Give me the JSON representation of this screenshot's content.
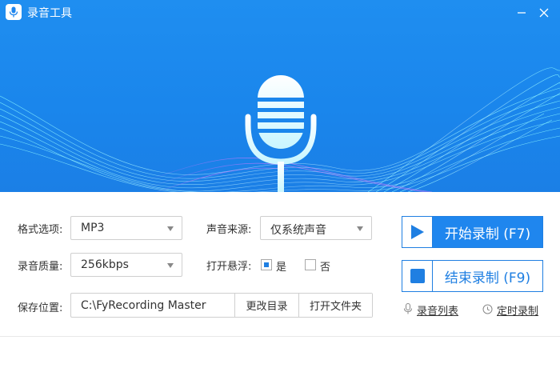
{
  "window": {
    "title": "录音工具"
  },
  "settings": {
    "format_label": "格式选项:",
    "format_value": "MP3",
    "quality_label": "录音质量:",
    "quality_value": "256kbps",
    "save_label": "保存位置:",
    "save_path": "C:\\FyRecording Master",
    "change_dir_label": "更改目录",
    "open_folder_label": "打开文件夹",
    "source_label": "声音来源:",
    "source_value": "仅系统声音",
    "float_label": "打开悬浮:",
    "float_yes": "是",
    "float_no": "否",
    "float_selected": "yes"
  },
  "actions": {
    "start_label": "开始录制 (F7)",
    "stop_label": "结束录制 (F9)",
    "list_label": "录音列表",
    "timer_label": "定时录制"
  },
  "colors": {
    "accent": "#1f86ee",
    "banner": "#1a86ec"
  },
  "icons": [
    "app-mic-icon",
    "minimize-icon",
    "close-icon",
    "microphone-icon",
    "play-icon",
    "stop-icon",
    "mic-list-icon",
    "clock-icon"
  ]
}
